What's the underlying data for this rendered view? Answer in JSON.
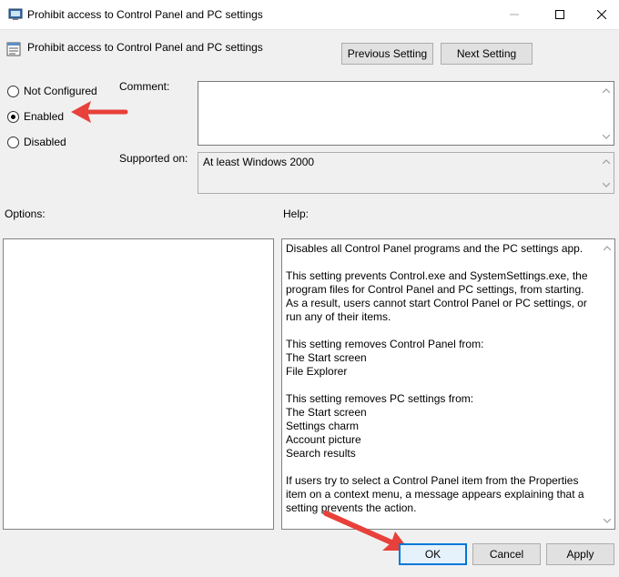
{
  "window": {
    "title": "Prohibit access to Control Panel and PC settings",
    "controls": {
      "minimize": "—",
      "maximize": "☐",
      "close": "✕"
    }
  },
  "header": {
    "setting_title": "Prohibit access to Control Panel and PC settings",
    "previous_label": "Previous Setting",
    "next_label": "Next Setting"
  },
  "state": {
    "options": [
      {
        "label": "Not Configured",
        "checked": false
      },
      {
        "label": "Enabled",
        "checked": true
      },
      {
        "label": "Disabled",
        "checked": false
      }
    ]
  },
  "comment": {
    "label": "Comment:",
    "value": ""
  },
  "supported": {
    "label": "Supported on:",
    "value": "At least Windows 2000"
  },
  "options_panel": {
    "label": "Options:"
  },
  "help_panel": {
    "label": "Help:",
    "text": "Disables all Control Panel programs and the PC settings app.\n\nThis setting prevents Control.exe and SystemSettings.exe, the program files for Control Panel and PC settings, from starting. As a result, users cannot start Control Panel or PC settings, or run any of their items.\n\nThis setting removes Control Panel from:\nThe Start screen\nFile Explorer\n\nThis setting removes PC settings from:\nThe Start screen\nSettings charm\nAccount picture\nSearch results\n\nIf users try to select a Control Panel item from the Properties item on a context menu, a message appears explaining that a setting prevents the action."
  },
  "footer": {
    "ok_label": "OK",
    "cancel_label": "Cancel",
    "apply_label": "Apply"
  },
  "colors": {
    "accent": "#0078d7",
    "annotation_arrow": "#e8403a"
  }
}
